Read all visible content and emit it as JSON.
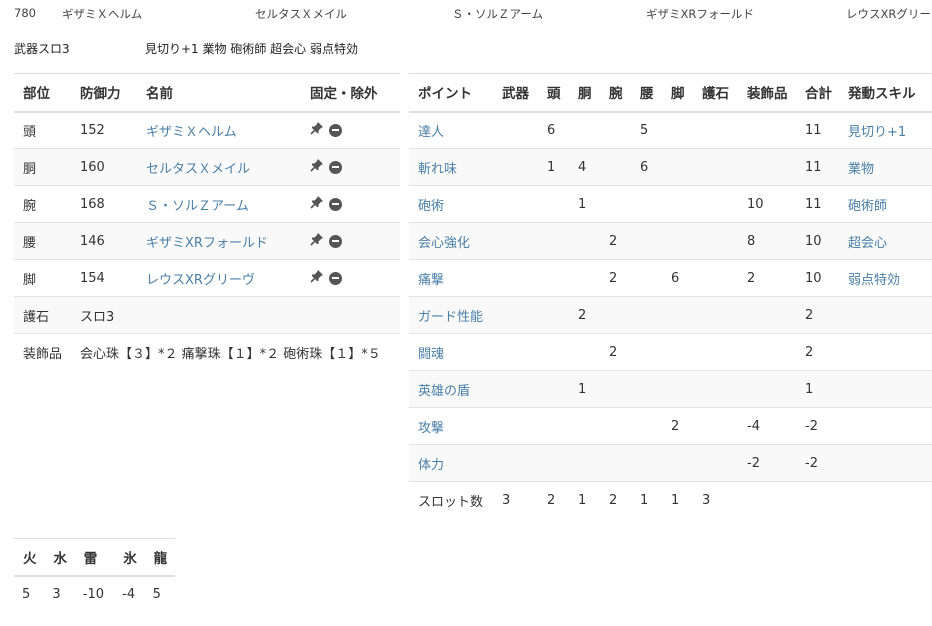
{
  "summary": {
    "defense": "780",
    "head": "ギザミＸヘルム",
    "body": "セルタスＸメイル",
    "arm": "Ｓ・ソルＺアーム",
    "waist": "ギザミXRフォールド",
    "leg": "レウスXRグリー"
  },
  "weapon_slot": "武器スロ3",
  "skills_line": "見切り+1 業物 砲術師 超会心 弱点特効",
  "armor_table": {
    "headers": [
      "部位",
      "防御力",
      "名前",
      "固定・除外"
    ],
    "rows": [
      {
        "part": "頭",
        "defense": "152",
        "name": "ギザミＸヘルム"
      },
      {
        "part": "胴",
        "defense": "160",
        "name": "セルタスＸメイル"
      },
      {
        "part": "腕",
        "defense": "168",
        "name": "Ｓ・ソルＺアーム"
      },
      {
        "part": "腰",
        "defense": "146",
        "name": "ギザミXRフォールド"
      },
      {
        "part": "脚",
        "defense": "154",
        "name": "レウスXRグリーヴ"
      }
    ],
    "charm_label": "護石",
    "charm_value": "スロ3",
    "deco_label": "装飾品",
    "deco_value": "会心珠【３】*２ 痛撃珠【１】*２ 砲術珠【１】*５"
  },
  "points_table": {
    "headers": [
      "ポイント",
      "武器",
      "頭",
      "胴",
      "腕",
      "腰",
      "脚",
      "護石",
      "装飾品",
      "合計",
      "発動スキル"
    ],
    "rows": [
      {
        "point": "達人",
        "weapon": "",
        "head": "6",
        "body": "",
        "arm": "",
        "waist": "5",
        "leg": "",
        "charm": "",
        "deco": "",
        "total": "11",
        "skill": "見切り+1"
      },
      {
        "point": "斬れ味",
        "weapon": "",
        "head": "1",
        "body": "4",
        "arm": "",
        "waist": "6",
        "leg": "",
        "charm": "",
        "deco": "",
        "total": "11",
        "skill": "業物"
      },
      {
        "point": "砲術",
        "weapon": "",
        "head": "",
        "body": "1",
        "arm": "",
        "waist": "",
        "leg": "",
        "charm": "",
        "deco": "10",
        "total": "11",
        "skill": "砲術師"
      },
      {
        "point": "会心強化",
        "weapon": "",
        "head": "",
        "body": "",
        "arm": "2",
        "waist": "",
        "leg": "",
        "charm": "",
        "deco": "8",
        "total": "10",
        "skill": "超会心"
      },
      {
        "point": "痛撃",
        "weapon": "",
        "head": "",
        "body": "",
        "arm": "2",
        "waist": "",
        "leg": "6",
        "charm": "",
        "deco": "2",
        "total": "10",
        "skill": "弱点特効"
      },
      {
        "point": "ガード性能",
        "weapon": "",
        "head": "",
        "body": "2",
        "arm": "",
        "waist": "",
        "leg": "",
        "charm": "",
        "deco": "",
        "total": "2",
        "skill": ""
      },
      {
        "point": "闘魂",
        "weapon": "",
        "head": "",
        "body": "",
        "arm": "2",
        "waist": "",
        "leg": "",
        "charm": "",
        "deco": "",
        "total": "2",
        "skill": ""
      },
      {
        "point": "英雄の盾",
        "weapon": "",
        "head": "",
        "body": "1",
        "arm": "",
        "waist": "",
        "leg": "",
        "charm": "",
        "deco": "",
        "total": "1",
        "skill": ""
      },
      {
        "point": "攻撃",
        "weapon": "",
        "head": "",
        "body": "",
        "arm": "",
        "waist": "",
        "leg": "2",
        "charm": "",
        "deco": "-4",
        "total": "-2",
        "skill": ""
      },
      {
        "point": "体力",
        "weapon": "",
        "head": "",
        "body": "",
        "arm": "",
        "waist": "",
        "leg": "",
        "charm": "",
        "deco": "-2",
        "total": "-2",
        "skill": ""
      }
    ],
    "slots": {
      "label": "スロット数",
      "weapon": "3",
      "head": "2",
      "body": "1",
      "arm": "2",
      "waist": "1",
      "leg": "1",
      "charm": "3"
    }
  },
  "resist_table": {
    "headers": [
      "火",
      "水",
      "雷",
      "氷",
      "龍"
    ],
    "values": [
      "5",
      "3",
      "-10",
      "-4",
      "5"
    ]
  },
  "icons": {
    "fix": "pin-icon",
    "exclude": "minus-circle-icon"
  },
  "colors": {
    "link": "#4a7fa8",
    "text": "#333333",
    "stripe": "#f9f9f9",
    "border": "#dddddd"
  }
}
